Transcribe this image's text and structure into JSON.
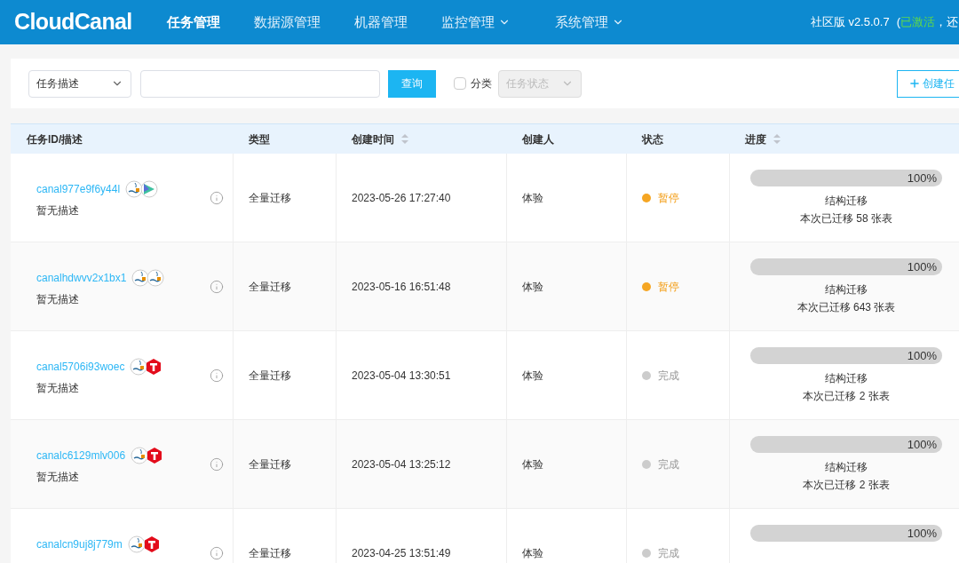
{
  "header": {
    "logo": "CloudCanal",
    "nav": [
      {
        "label": "任务管理",
        "selected": true,
        "dropdown": false
      },
      {
        "label": "数据源管理",
        "selected": false,
        "dropdown": false
      },
      {
        "label": "机器管理",
        "selected": false,
        "dropdown": false
      },
      {
        "label": "监控管理",
        "selected": false,
        "dropdown": true
      },
      {
        "label": "系统管理",
        "selected": false,
        "dropdown": true
      }
    ],
    "edition": "社区版 v2.5.0.7",
    "paren": "(",
    "activated": "已激活",
    "rest": "，还"
  },
  "filter": {
    "select": "任务描述",
    "query_button": "查询",
    "category": {
      "label": "分类",
      "checked": false
    },
    "status_select": {
      "placeholder": "任务状态",
      "disabled": true
    },
    "create_button": "创建任"
  },
  "table": {
    "columns": [
      {
        "label": "任务ID/描述",
        "sortable": false
      },
      {
        "label": "类型",
        "sortable": false
      },
      {
        "label": "创建时间",
        "sortable": true
      },
      {
        "label": "创建人",
        "sortable": false
      },
      {
        "label": "状态",
        "sortable": false
      },
      {
        "label": "进度",
        "sortable": true
      }
    ],
    "rows": [
      {
        "id": "canal977e9f6y44l",
        "description": "暂无描述",
        "databases": {
          "kind": "greenplum"
        },
        "type": "全量迁移",
        "created": "2023-05-26 17:27:40",
        "creator": "体验",
        "status": {
          "label": "暂停",
          "kind": "paused",
          "color": "#f5a623"
        },
        "level": 1,
        "percent": "100%",
        "stage": "结构迁移",
        "summary": "本次已迁移 58 张表"
      },
      {
        "id": "canalhdwvv2x1bx1",
        "description": "暂无描述",
        "databases": {
          "kind": "mysql"
        },
        "type": "全量迁移",
        "created": "2023-05-16 16:51:48",
        "creator": "体验",
        "status": {
          "label": "暂停",
          "kind": "paused",
          "color": "#f5a623"
        },
        "level": 1,
        "percent": "100%",
        "stage": "结构迁移",
        "summary": "本次已迁移 643 张表"
      },
      {
        "id": "canal5706i93woec",
        "description": "暂无描述",
        "databases": {
          "kind": "tidb"
        },
        "type": "全量迁移",
        "created": "2023-05-04 13:30:51",
        "creator": "体验",
        "status": {
          "label": "完成",
          "kind": "done",
          "color": "#cccccc"
        },
        "level": 1,
        "percent": "100%",
        "stage": "结构迁移",
        "summary": "本次已迁移 2 张表"
      },
      {
        "id": "canalc6129mlv006",
        "description": "暂无描述",
        "databases": {
          "kind": "tidb"
        },
        "type": "全量迁移",
        "created": "2023-05-04 13:25:12",
        "creator": "体验",
        "status": {
          "label": "完成",
          "kind": "done",
          "color": "#cccccc"
        },
        "level": 1,
        "percent": "100%",
        "stage": "结构迁移",
        "summary": "本次已迁移 2 张表"
      },
      {
        "id": "canalcn9uj8j779m",
        "databases": {
          "kind": "tidb"
        },
        "type": "全量迁移",
        "created": "2023-04-25 13:51:49",
        "creator": "体验",
        "status": {
          "label": "完成",
          "kind": "done",
          "color": "#cccccc"
        },
        "level": 1,
        "percent": "100%"
      }
    ]
  }
}
